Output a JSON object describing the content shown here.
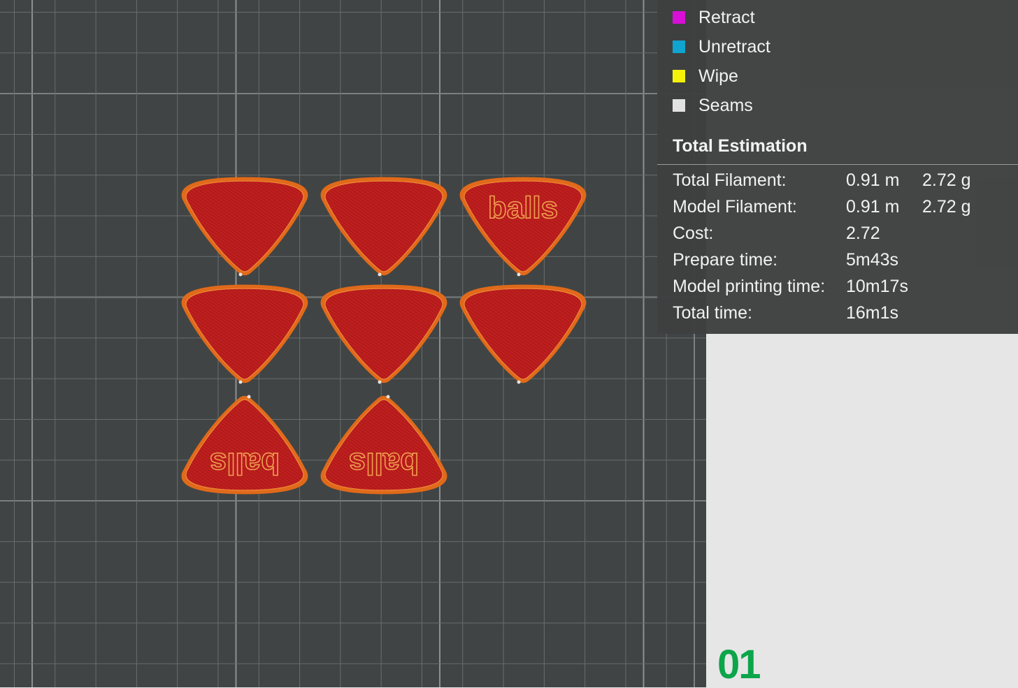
{
  "legend": {
    "items": [
      {
        "label": "Retract",
        "color": "#d70fd7"
      },
      {
        "label": "Unretract",
        "color": "#10a5d0"
      },
      {
        "label": "Wipe",
        "color": "#f5f20a"
      },
      {
        "label": "Seams",
        "color": "#e2e2e2"
      }
    ]
  },
  "estimation": {
    "title": "Total Estimation",
    "rows": [
      {
        "label": "Total Filament:",
        "value": "0.91 m",
        "value2": "2.72 g"
      },
      {
        "label": "Model Filament:",
        "value": "0.91 m",
        "value2": "2.72 g"
      },
      {
        "label": "Cost:",
        "value": "2.72",
        "value2": ""
      },
      {
        "label": "Prepare time:",
        "value": "5m43s",
        "value2": ""
      },
      {
        "label": "Model printing time:",
        "value": "10m17s",
        "value2": ""
      },
      {
        "label": "Total time:",
        "value": "16m1s",
        "value2": ""
      }
    ]
  },
  "viewport": {
    "pick_fill": "#c01f1f",
    "pick_outline": "#e06a1a",
    "pick_text": "balls",
    "picks": [
      {
        "id": 1,
        "orientation": "down",
        "has_text": false
      },
      {
        "id": 2,
        "orientation": "down",
        "has_text": false
      },
      {
        "id": 3,
        "orientation": "down",
        "has_text": true
      },
      {
        "id": 4,
        "orientation": "down",
        "has_text": false
      },
      {
        "id": 5,
        "orientation": "down",
        "has_text": false
      },
      {
        "id": 6,
        "orientation": "down",
        "has_text": false
      },
      {
        "id": 7,
        "orientation": "up",
        "has_text": true
      },
      {
        "id": 8,
        "orientation": "up",
        "has_text": true
      }
    ]
  },
  "plate": {
    "number": "01",
    "color": "#0ca54a"
  }
}
